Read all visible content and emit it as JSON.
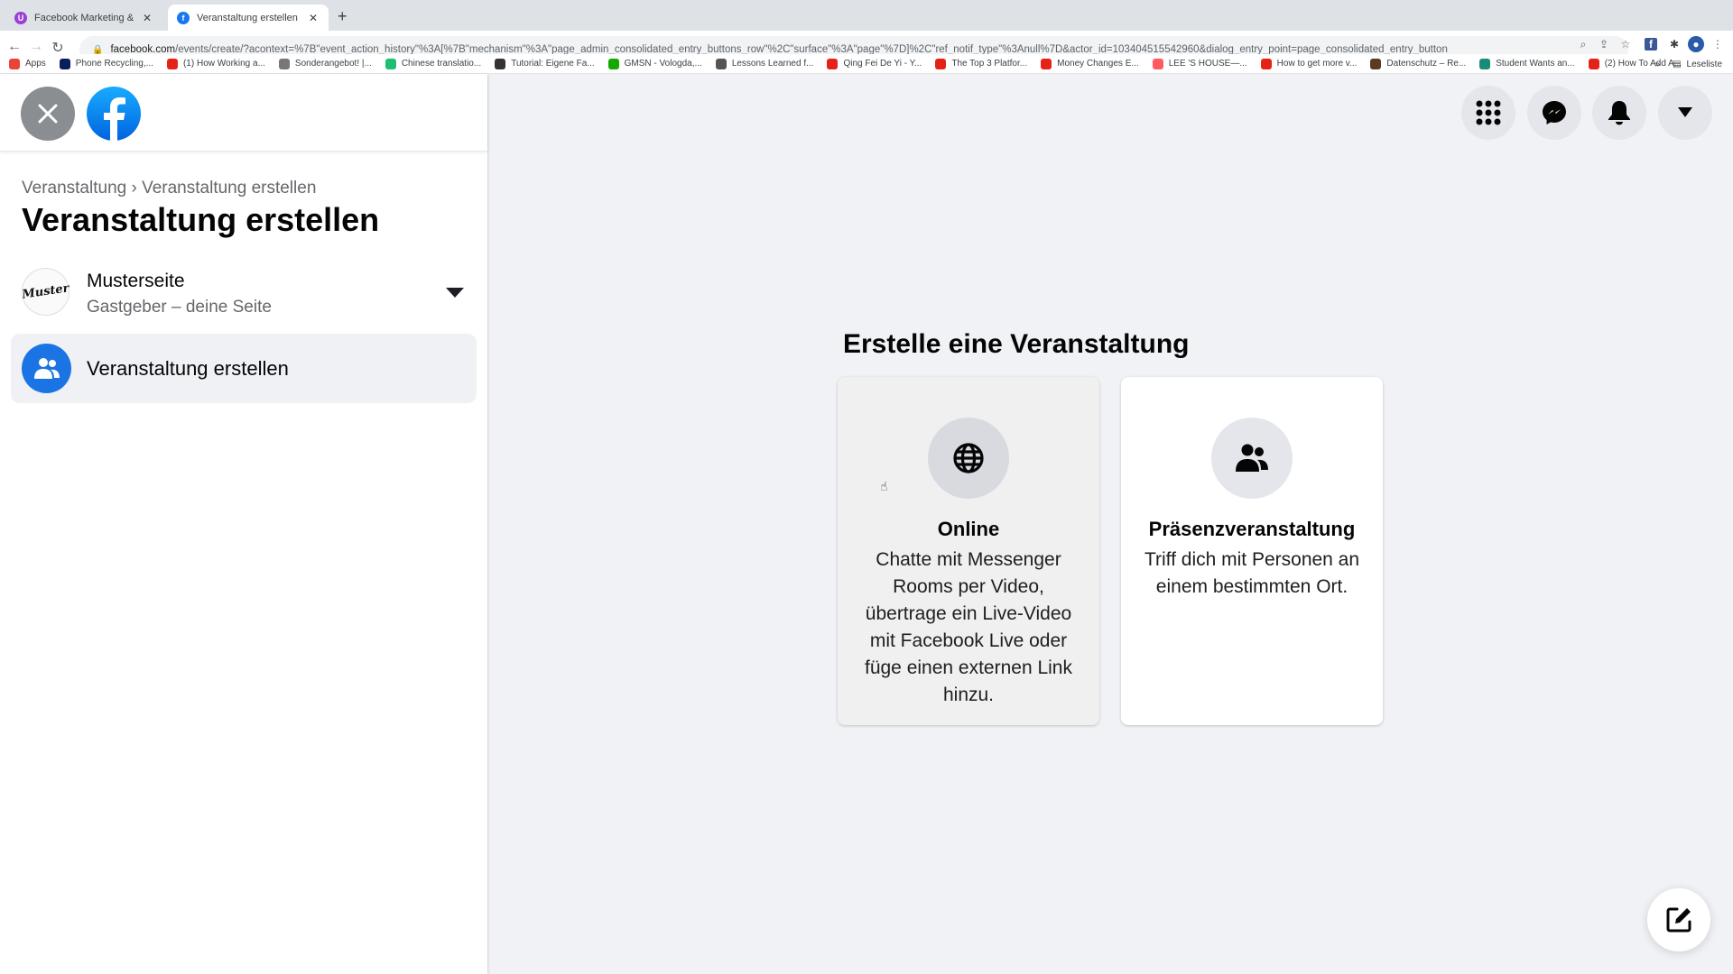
{
  "browser": {
    "tabs": [
      {
        "title": "Facebook Marketing & Werbeanzeigen",
        "active": false,
        "favicon_color": "#9b3fd6"
      },
      {
        "title": "Veranstaltung erstellen | Facebook",
        "active": true,
        "favicon_color": "#1877f2"
      }
    ],
    "new_tab_label": "+",
    "url_host": "facebook.com",
    "url_path": "/events/create/?acontext=%7B\"event_action_history\"%3A[%7B\"mechanism\"%3A\"page_admin_consolidated_entry_buttons_row\"%2C\"surface\"%3A\"page\"%7D]%2C\"ref_notif_type\"%3Anull%7D&actor_id=103404515542960&dialog_entry_point=page_consolidated_entry_button",
    "bookmarks": [
      {
        "label": "Apps",
        "icon": "apps-grid-icon",
        "color": "#ea4335"
      },
      {
        "label": "Phone Recycling,...",
        "icon": "o2-icon",
        "color": "#0a1e5e"
      },
      {
        "label": "(1) How Working a...",
        "icon": "youtube-icon",
        "color": "#e62117"
      },
      {
        "label": "Sonderangebot! |...",
        "icon": "check-circle-icon",
        "color": "#777777"
      },
      {
        "label": "Chinese translatio...",
        "icon": "fiverr-icon",
        "color": "#1dbf73"
      },
      {
        "label": "Tutorial: Eigene Fa...",
        "icon": "hash-icon",
        "color": "#333333"
      },
      {
        "label": "GMSN - Vologda,...",
        "icon": "upwork-icon",
        "color": "#14a800"
      },
      {
        "label": "Lessons Learned f...",
        "icon": "percent-icon",
        "color": "#555555"
      },
      {
        "label": "Qing Fei De Yi - Y...",
        "icon": "youtube-icon",
        "color": "#e62117"
      },
      {
        "label": "The Top 3 Platfor...",
        "icon": "youtube-icon",
        "color": "#e62117"
      },
      {
        "label": "Money Changes E...",
        "icon": "youtube-icon",
        "color": "#e62117"
      },
      {
        "label": "LEE 'S HOUSE—...",
        "icon": "airbnb-icon",
        "color": "#ff5a5f"
      },
      {
        "label": "How to get more v...",
        "icon": "youtube-icon",
        "color": "#e62117"
      },
      {
        "label": "Datenschutz – Re...",
        "icon": "photo-icon",
        "color": "#5a3a22"
      },
      {
        "label": "Student Wants an...",
        "icon": "t-icon",
        "color": "#1a8a7a"
      },
      {
        "label": "(2) How To Add A...",
        "icon": "youtube-icon",
        "color": "#e62117"
      }
    ],
    "bookmarks_overflow": "»",
    "reading_list_label": "Leseliste"
  },
  "left_panel": {
    "breadcrumb": {
      "parent": "Veranstaltung",
      "separator": "›",
      "current": "Veranstaltung erstellen"
    },
    "title": "Veranstaltung erstellen",
    "host": {
      "name": "Musterseite",
      "subtitle": "Gastgeber – deine Seite",
      "avatar_text": "Muster"
    },
    "menu_item": {
      "label": "Veranstaltung erstellen"
    }
  },
  "main": {
    "title": "Erstelle eine Veranstaltung",
    "cards": [
      {
        "title": "Online",
        "description": "Chatte mit Messenger Rooms per Video, übertrage ein Live-Video mit Facebook Live oder füge einen externen Link hinzu.",
        "icon": "globe-icon"
      },
      {
        "title": "Präsenzveranstaltung",
        "description": "Triff dich mit Personen an einem bestimmten Ort.",
        "icon": "people-icon"
      }
    ]
  },
  "colors": {
    "fb_blue": "#1877f2",
    "accent": "#1b74e4",
    "background": "#f0f2f5"
  }
}
